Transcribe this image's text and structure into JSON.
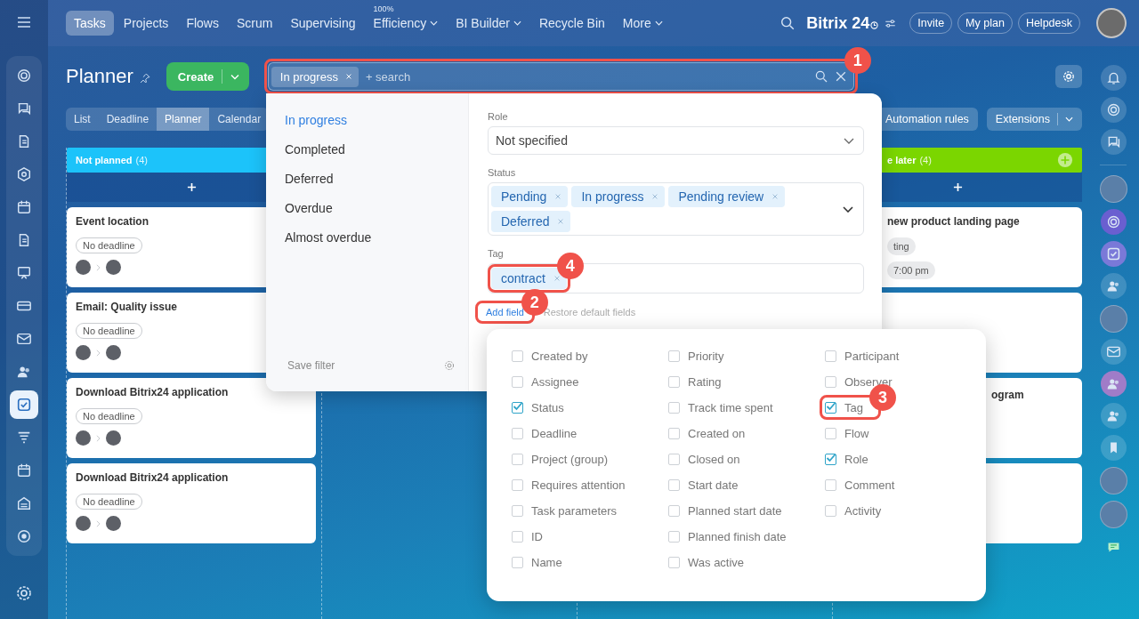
{
  "left_sidebar": {
    "items": [
      {
        "kind": "swirl",
        "selected": false
      },
      {
        "kind": "chat",
        "selected": false
      },
      {
        "kind": "doc",
        "selected": false
      },
      {
        "kind": "hexagon",
        "selected": false
      },
      {
        "kind": "calendar",
        "selected": false
      },
      {
        "kind": "file",
        "selected": false
      },
      {
        "kind": "board",
        "selected": false
      },
      {
        "kind": "card",
        "selected": false
      },
      {
        "kind": "mail",
        "selected": false
      },
      {
        "kind": "people",
        "selected": false
      },
      {
        "kind": "check",
        "selected": true
      },
      {
        "kind": "funnel",
        "selected": false
      },
      {
        "kind": "calendar",
        "selected": false
      },
      {
        "kind": "storage",
        "selected": false
      },
      {
        "kind": "target",
        "selected": false
      }
    ]
  },
  "top_nav": [
    {
      "label": "Tasks",
      "selected": true,
      "dropdown": false
    },
    {
      "label": "Projects",
      "selected": false,
      "dropdown": false
    },
    {
      "label": "Flows",
      "selected": false,
      "dropdown": false
    },
    {
      "label": "Scrum",
      "selected": false,
      "dropdown": false
    },
    {
      "label": "Supervising",
      "selected": false,
      "dropdown": false
    },
    {
      "label": "Efficiency",
      "badge": "100%",
      "selected": false,
      "dropdown": true
    },
    {
      "label": "BI Builder",
      "selected": false,
      "dropdown": true
    },
    {
      "label": "Recycle Bin",
      "selected": false,
      "dropdown": false
    },
    {
      "label": "More",
      "selected": false,
      "dropdown": true
    }
  ],
  "header": {
    "brand": "Bitrix 24",
    "buttons": [
      "Invite",
      "My plan",
      "Helpdesk"
    ]
  },
  "page": {
    "title": "Planner",
    "create_button": "Create",
    "filter": {
      "chips": [
        "In progress"
      ],
      "placeholder": "+ search",
      "callout": "1"
    },
    "view_tabs": [
      {
        "label": "List",
        "selected": false
      },
      {
        "label": "Deadline",
        "selected": false
      },
      {
        "label": "Planner",
        "selected": true
      },
      {
        "label": "Calendar",
        "selected": false
      }
    ],
    "automation_button": "Automation rules",
    "extensions_button": "Extensions"
  },
  "columns": [
    {
      "kind": "open",
      "title": "Not planned",
      "count": "(4)",
      "color": "#1cc3fa",
      "cards": [
        {
          "title": "Event location",
          "chips": [
            {
              "label": "No deadline",
              "kind": "outlined"
            }
          ],
          "avatars": true
        },
        {
          "title": "Email: Quality issue",
          "chips": [
            {
              "label": "No deadline",
              "kind": "outlined"
            }
          ],
          "avatars": true
        },
        {
          "title": "Download Bitrix24 application",
          "chips": [
            {
              "label": "No deadline",
              "kind": "outlined"
            }
          ],
          "avatars": true
        },
        {
          "title": "Download Bitrix24 application",
          "chips": [
            {
              "label": "No deadline",
              "kind": "outlined"
            }
          ],
          "avatars": true
        }
      ]
    },
    {
      "kind": "covered"
    },
    {
      "kind": "covered"
    },
    {
      "kind": "clipped",
      "title": "e later",
      "count": "(4)",
      "color": "#7bd600",
      "cards": [
        {
          "kind": "task",
          "title": "new product landing page",
          "chips": [
            {
              "label": "ting",
              "kind": "filled"
            },
            {
              "label": "7:00 pm",
              "kind": "filled"
            }
          ]
        },
        {
          "kind": "blank"
        },
        {
          "kind": "task",
          "title": "ogram"
        },
        {
          "kind": "blank"
        }
      ]
    }
  ],
  "filter_panel": {
    "presets": [
      {
        "label": "In progress",
        "selected": true
      },
      {
        "label": "Completed",
        "selected": false
      },
      {
        "label": "Deferred",
        "selected": false
      },
      {
        "label": "Overdue",
        "selected": false
      },
      {
        "label": "Almost overdue",
        "selected": false
      }
    ],
    "save_filter": "Save filter",
    "fields": [
      {
        "kind": "select",
        "label": "Role",
        "value": "Not specified"
      },
      {
        "kind": "multiselect",
        "label": "Status",
        "values": [
          "Pending",
          "In progress",
          "Pending review",
          "Deferred"
        ]
      },
      {
        "kind": "tags",
        "label": "Tag",
        "values": [
          {
            "label": "contract",
            "callout": "4"
          }
        ]
      }
    ],
    "add_field": "Add field",
    "add_field_callout": "2",
    "restore": "Restore default fields"
  },
  "field_chooser": {
    "columns": [
      [
        {
          "label": "Created by",
          "checked": false
        },
        {
          "label": "Assignee",
          "checked": false
        },
        {
          "label": "Status",
          "checked": true
        },
        {
          "label": "Deadline",
          "checked": false
        },
        {
          "label": "Project (group)",
          "checked": false
        },
        {
          "label": "Requires attention",
          "checked": false
        },
        {
          "label": "Task parameters",
          "checked": false
        },
        {
          "label": "ID",
          "checked": false
        },
        {
          "label": "Name",
          "checked": false
        }
      ],
      [
        {
          "label": "Priority",
          "checked": false
        },
        {
          "label": "Rating",
          "checked": false
        },
        {
          "label": "Track time spent",
          "checked": false
        },
        {
          "label": "Created on",
          "checked": false
        },
        {
          "label": "Closed on",
          "checked": false
        },
        {
          "label": "Start date",
          "checked": false
        },
        {
          "label": "Planned start date",
          "checked": false
        },
        {
          "label": "Planned finish date",
          "checked": false
        },
        {
          "label": "Was active",
          "checked": false
        }
      ],
      [
        {
          "label": "Participant",
          "checked": false
        },
        {
          "label": "Observer",
          "checked": false
        },
        {
          "label": "Tag",
          "checked": true,
          "callout": "3"
        },
        {
          "label": "Flow",
          "checked": false
        },
        {
          "label": "Role",
          "checked": true
        },
        {
          "label": "Comment",
          "checked": false
        },
        {
          "label": "Activity",
          "checked": false
        }
      ]
    ]
  },
  "right_sidebar": [
    {
      "kind": "bell"
    },
    {
      "kind": "swirl"
    },
    {
      "kind": "chat"
    },
    {
      "kind": "divider"
    },
    {
      "kind": "avatar"
    },
    {
      "kind": "swirl-purple"
    },
    {
      "kind": "check"
    },
    {
      "kind": "group"
    },
    {
      "kind": "avatar"
    },
    {
      "kind": "mail"
    },
    {
      "kind": "people-purple"
    },
    {
      "kind": "people"
    },
    {
      "kind": "bookmark"
    },
    {
      "kind": "avatar"
    },
    {
      "kind": "avatar"
    },
    {
      "kind": "message"
    }
  ]
}
